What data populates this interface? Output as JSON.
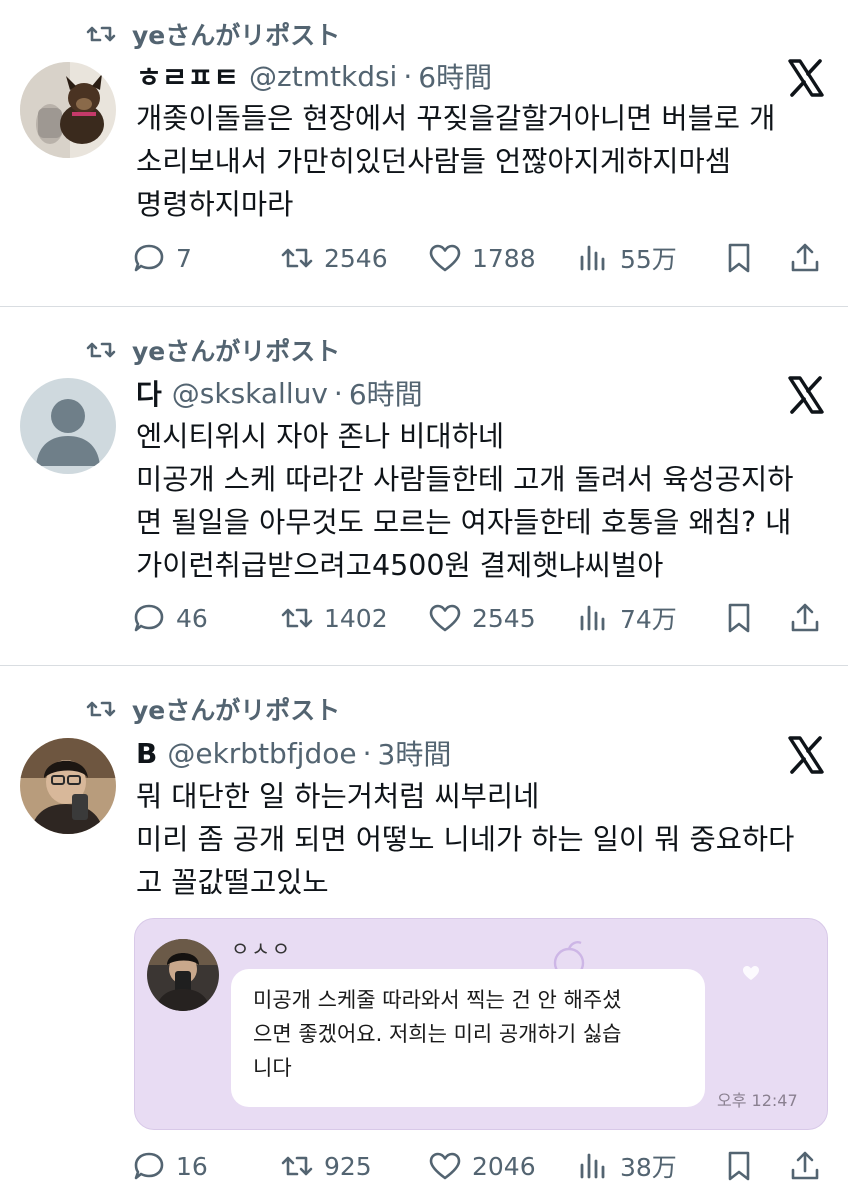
{
  "colors": {
    "secondary_text": "#536471",
    "divider": "#d9dde1",
    "embed_bg": "#e8dcf3"
  },
  "tweets": [
    {
      "repost_label": "yeさんがリポスト",
      "display_name": "ㅎㄹㅍㅌ",
      "handle": "@ztmtkdsi",
      "dot": "·",
      "time": "6時間",
      "lines": [
        "개좆이돌들은 현장에서 꾸짖을갈할거아니면 버블로 개",
        "소리보내서 가만히있던사람들 언짢아지게하지마셈",
        "명령하지마라"
      ],
      "replies": "7",
      "reposts": "2546",
      "likes": "1788",
      "views": "55万"
    },
    {
      "repost_label": "yeさんがリポスト",
      "display_name": "다",
      "handle": "@skskalluv",
      "dot": "·",
      "time": "6時間",
      "lines": [
        "엔시티위시 자아 존나 비대하네",
        "미공개 스케 따라간 사람들한테 고개 돌려서 육성공지하",
        "면 될일을 아무것도 모르는 여자들한테 호통을 왜침? 내",
        "가이런취급받으려고4500원 결제햇냐씨벌아"
      ],
      "replies": "46",
      "reposts": "1402",
      "likes": "2545",
      "views": "74万"
    },
    {
      "repost_label": "yeさんがリポスト",
      "display_name": "B",
      "handle": "@ekrbtbfjdoe",
      "dot": "·",
      "time": "3時間",
      "lines": [
        "뭐 대단한 일 하는거처럼 씨부리네",
        "미리 좀 공개 되면 어떻노 니네가 하는 일이 뭐 중요하다",
        "고 꼴값떨고있노"
      ],
      "embed": {
        "name": "ㅇㅅㅇ",
        "message_lines": [
          "미공개 스케줄 따라와서 찍는 건 안 해주셨",
          "으면 좋겠어요. 저희는 미리 공개하기 싫습",
          "니다"
        ],
        "time": "오후 12:47"
      },
      "replies": "16",
      "reposts": "925",
      "likes": "2046",
      "views": "38万"
    }
  ]
}
